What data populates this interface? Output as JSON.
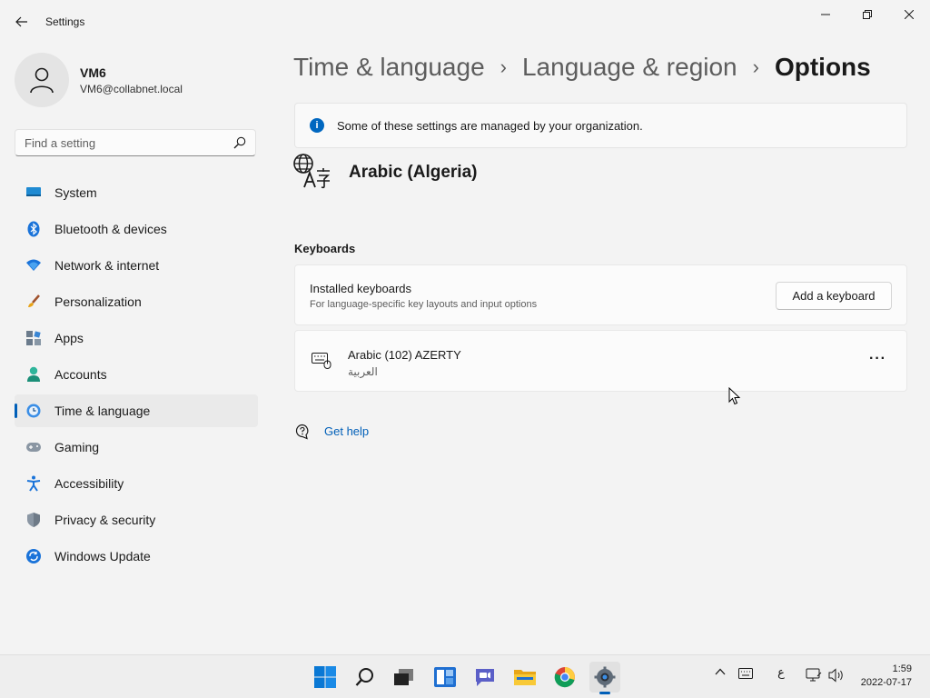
{
  "window": {
    "title": "Settings"
  },
  "profile": {
    "name": "VM6",
    "email": "VM6@collabnet.local"
  },
  "search": {
    "placeholder": "Find a setting"
  },
  "nav": {
    "items": [
      {
        "label": "System",
        "icon": "monitor-icon"
      },
      {
        "label": "Bluetooth & devices",
        "icon": "bluetooth-icon"
      },
      {
        "label": "Network & internet",
        "icon": "wifi-icon"
      },
      {
        "label": "Personalization",
        "icon": "brush-icon"
      },
      {
        "label": "Apps",
        "icon": "apps-icon"
      },
      {
        "label": "Accounts",
        "icon": "person-icon"
      },
      {
        "label": "Time & language",
        "icon": "globe-clock-icon",
        "active": true
      },
      {
        "label": "Gaming",
        "icon": "gamepad-icon"
      },
      {
        "label": "Accessibility",
        "icon": "accessibility-icon"
      },
      {
        "label": "Privacy & security",
        "icon": "shield-icon"
      },
      {
        "label": "Windows Update",
        "icon": "update-icon"
      }
    ]
  },
  "breadcrumb": {
    "items": [
      "Time & language",
      "Language & region"
    ],
    "current": "Options",
    "separator": "›"
  },
  "info": {
    "text": "Some of these settings are managed by your organization."
  },
  "language": {
    "name": "Arabic (Algeria)"
  },
  "keyboards": {
    "section_title": "Keyboards",
    "installed_title": "Installed keyboards",
    "installed_subtitle": "For language-specific key layouts and input options",
    "add_button": "Add a keyboard",
    "items": [
      {
        "name": "Arabic (102) AZERTY",
        "language": "العربية"
      }
    ],
    "more_label": "···"
  },
  "help": {
    "label": "Get help"
  },
  "taskbar": {
    "apps": [
      "start-icon",
      "search-icon",
      "task-view-icon",
      "widgets-icon",
      "chat-icon",
      "file-explorer-icon",
      "chrome-icon",
      "settings-icon"
    ],
    "input_indicator": "ع",
    "time": "1:59",
    "date": "2022-07-17"
  },
  "colors": {
    "accent": "#005fb8",
    "background": "#f3f3f3"
  }
}
